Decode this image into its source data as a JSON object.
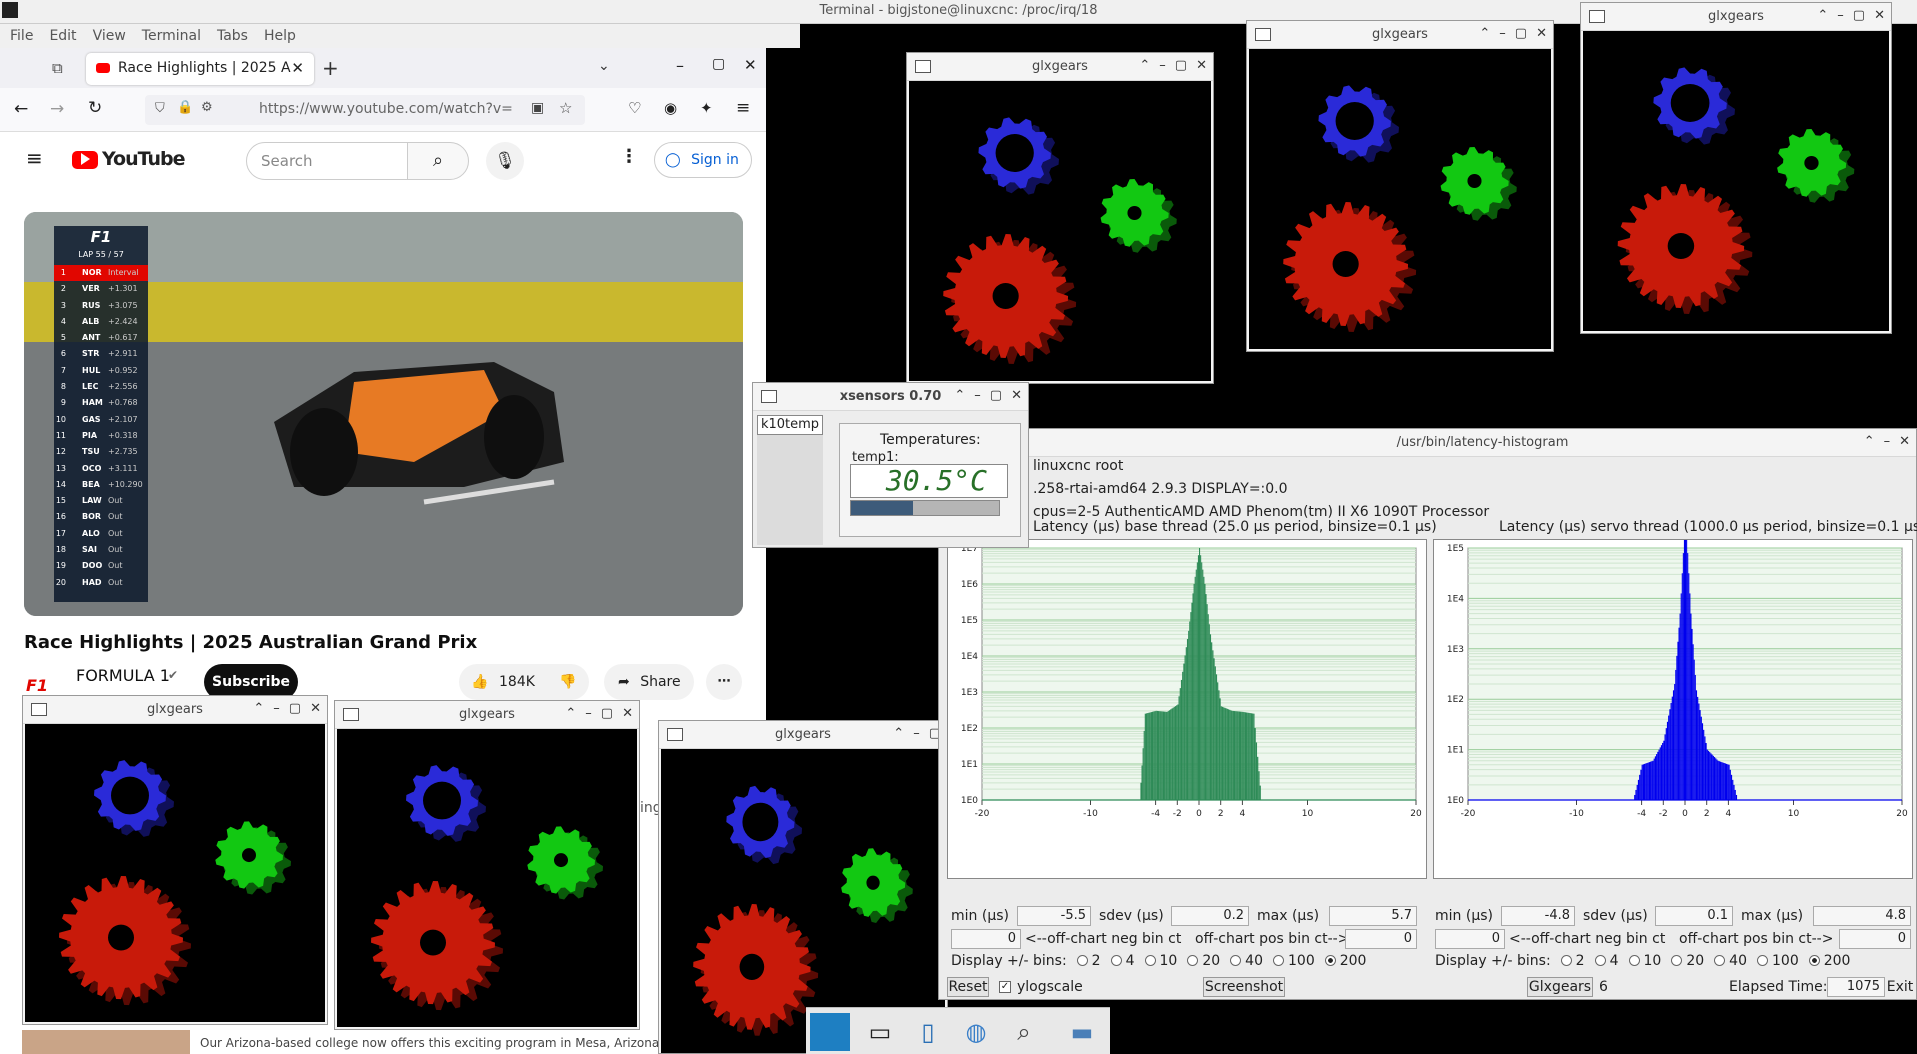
{
  "terminal": {
    "title": "Terminal - bigjstone@linuxcnc: /proc/irq/18",
    "menu": [
      "File",
      "Edit",
      "View",
      "Terminal",
      "Tabs",
      "Help"
    ]
  },
  "browser": {
    "tab_title": "Race Highlights | 2025 A",
    "url": "https://www.youtube.com/watch?v=",
    "search_placeholder": "Search",
    "sign_in": "Sign in",
    "logo_text": "YouTube",
    "video_title": "Race Highlights | 2025 Australian Grand Prix",
    "channel": "FORMULA 1",
    "subscribe": "Subscribe",
    "likes": "184K",
    "share": "Share",
    "ad_text": "Our Arizona-based college now offers this exciting program in Mesa, Arizona.",
    "partial_text": "ing",
    "overlay": {
      "lap": "LAP 55 / 57",
      "rows": [
        {
          "pos": "1",
          "name": "NOR",
          "gap": "Interval"
        },
        {
          "pos": "2",
          "name": "VER",
          "gap": "+1.301"
        },
        {
          "pos": "3",
          "name": "RUS",
          "gap": "+3.075"
        },
        {
          "pos": "4",
          "name": "ALB",
          "gap": "+2.424"
        },
        {
          "pos": "5",
          "name": "ANT",
          "gap": "+0.617"
        },
        {
          "pos": "6",
          "name": "STR",
          "gap": "+2.911"
        },
        {
          "pos": "7",
          "name": "HUL",
          "gap": "+0.952"
        },
        {
          "pos": "8",
          "name": "LEC",
          "gap": "+2.556"
        },
        {
          "pos": "9",
          "name": "HAM",
          "gap": "+0.768"
        },
        {
          "pos": "10",
          "name": "GAS",
          "gap": "+2.107"
        },
        {
          "pos": "11",
          "name": "PIA",
          "gap": "+0.318"
        },
        {
          "pos": "12",
          "name": "TSU",
          "gap": "+2.735"
        },
        {
          "pos": "13",
          "name": "OCO",
          "gap": "+3.111"
        },
        {
          "pos": "14",
          "name": "BEA",
          "gap": "+10.290"
        },
        {
          "pos": "15",
          "name": "LAW",
          "gap": "Out"
        },
        {
          "pos": "16",
          "name": "BOR",
          "gap": "Out"
        },
        {
          "pos": "17",
          "name": "ALO",
          "gap": "Out"
        },
        {
          "pos": "18",
          "name": "SAI",
          "gap": "Out"
        },
        {
          "pos": "19",
          "name": "DOO",
          "gap": "Out"
        },
        {
          "pos": "20",
          "name": "HAD",
          "gap": "Out"
        }
      ]
    }
  },
  "glxgears_title": "glxgears",
  "xsensors": {
    "title": "xsensors 0.70",
    "tab": "k10temp",
    "group": "Temperatures:",
    "label": "temp1:",
    "value": "30.5°C",
    "bar_fraction": 0.42
  },
  "latency": {
    "title": "/usr/bin/latency-histogram",
    "info1": "linuxcnc root",
    "info2": ".258-rtai-amd64  2.9.3  DISPLAY=:0.0",
    "info3": "cpus=2-5   AuthenticAMD  AMD Phenom(tm) II X6 1090T Processor",
    "base": {
      "title": "Latency (µs) base thread (25.0 µs period, binsize=0.1 µs)",
      "min": "-5.5",
      "sdev": "0.2",
      "max": "5.7",
      "neg": "0",
      "pos": "0"
    },
    "servo": {
      "title": "Latency (µs) servo thread (1000.0 µs period, binsize=0.1 µs)",
      "min": "-4.8",
      "sdev": "0.1",
      "max": "4.8",
      "neg": "0",
      "pos": "0"
    },
    "min_label": "min (µs)",
    "sdev_label": "sdev (µs)",
    "max_label": "max (µs)",
    "neg_label": "<--off-chart neg bin ct",
    "pos_label": "off-chart pos bin ct-->",
    "bins_label": "Display +/- bins:",
    "bins": [
      "2",
      "4",
      "10",
      "20",
      "40",
      "100",
      "200"
    ],
    "reset": "Reset",
    "ylog": "ylogscale",
    "screenshot": "Screenshot",
    "glx": "Glxgears",
    "glx_count": "6",
    "elapsed_label": "Elapsed Time:",
    "elapsed": "1075",
    "exit": "Exit"
  },
  "chart_data": [
    {
      "type": "bar",
      "title": "Latency (µs) base thread (25.0 µs period, binsize=0.1 µs)",
      "x_ticks": [
        "-20",
        "-10",
        "-4",
        "-2",
        "0",
        "2",
        "4",
        "10",
        "20"
      ],
      "y_ticks": [
        "1E0",
        "1E1",
        "1E2",
        "1E3",
        "1E4",
        "1E5",
        "1E6",
        "1E7"
      ],
      "yscale": "log",
      "xlim": [
        -20,
        20
      ],
      "color": "#2e8b57",
      "x": [
        -5.5,
        -5.0,
        -4.0,
        -3.0,
        -2.0,
        -1.0,
        -0.5,
        0.0,
        0.5,
        1.0,
        2.0,
        3.0,
        4.0,
        5.0,
        5.7
      ],
      "y": [
        1,
        250,
        300,
        280,
        450,
        50000,
        1000000,
        10000000,
        1000000,
        40000,
        400,
        300,
        280,
        250,
        1
      ]
    },
    {
      "type": "bar",
      "title": "Latency (µs) servo thread (1000.0 µs period, binsize=0.1 µs)",
      "x_ticks": [
        "-20",
        "-10",
        "-4",
        "-2",
        "0",
        "2",
        "4",
        "10",
        "20"
      ],
      "y_ticks": [
        "1E0",
        "1E1",
        "1E2",
        "1E3",
        "1E4",
        "1E5"
      ],
      "yscale": "log",
      "xlim": [
        -20,
        20
      ],
      "color": "#0000ee",
      "x": [
        -4.8,
        -4.0,
        -3.0,
        -2.0,
        -1.0,
        -0.5,
        0.0,
        0.5,
        1.0,
        2.0,
        3.0,
        4.0,
        4.8
      ],
      "y": [
        1,
        5,
        6,
        15,
        200,
        5000,
        500000,
        5000,
        150,
        10,
        6,
        5,
        1
      ]
    }
  ]
}
